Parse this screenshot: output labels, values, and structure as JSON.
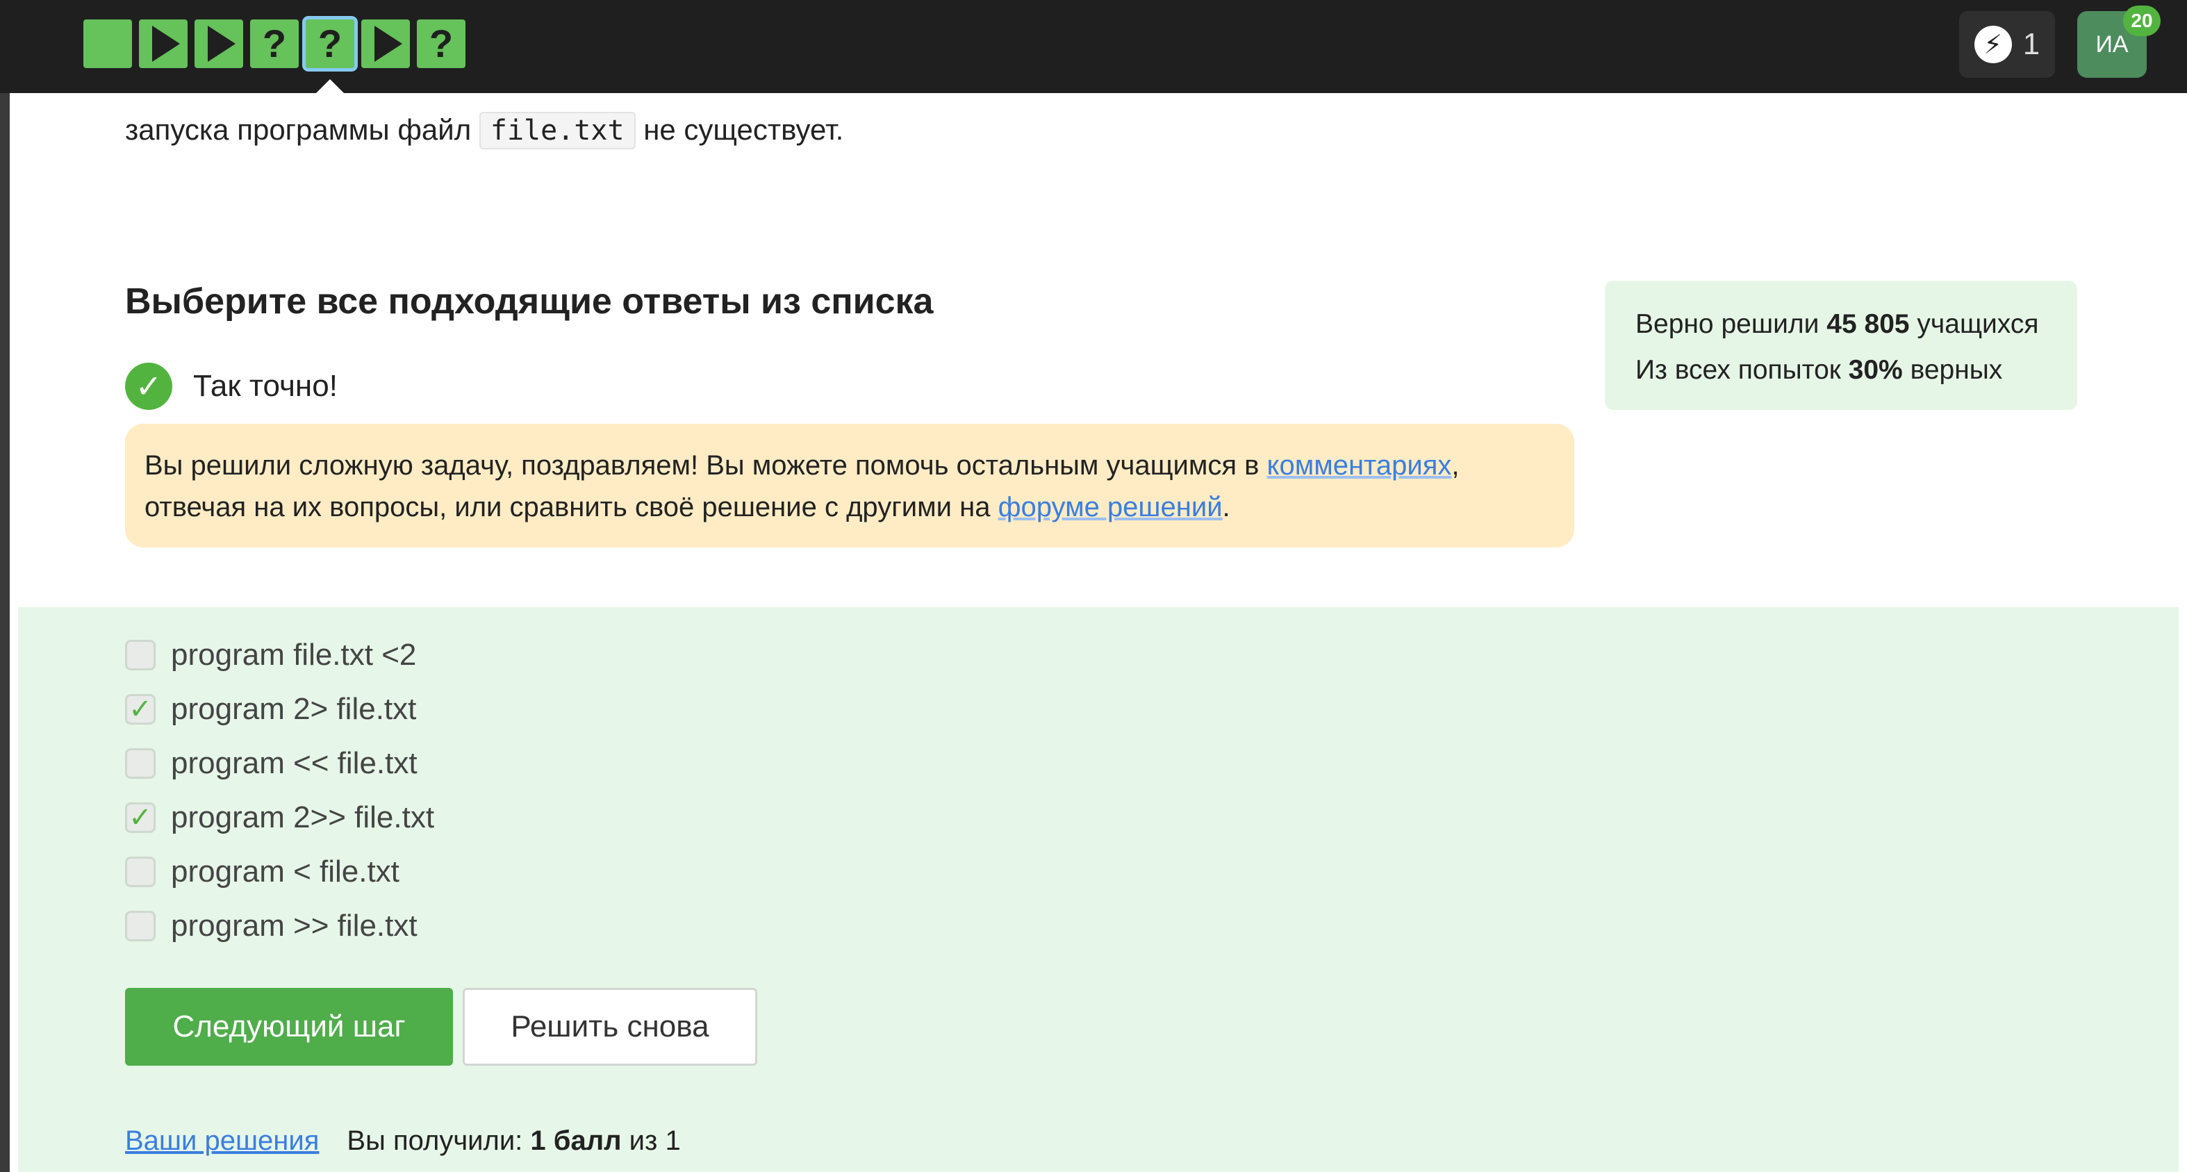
{
  "topbar": {
    "steps": [
      {
        "type": "text",
        "icon": "text-step-icon",
        "label": ""
      },
      {
        "type": "video",
        "icon": "play-icon",
        "label": ""
      },
      {
        "type": "video",
        "icon": "play-icon",
        "label": ""
      },
      {
        "type": "quiz",
        "icon": "question-icon",
        "label": "?"
      },
      {
        "type": "quiz",
        "icon": "question-icon",
        "label": "?",
        "current": true
      },
      {
        "type": "video",
        "icon": "play-icon",
        "label": ""
      },
      {
        "type": "quiz",
        "icon": "question-icon",
        "label": "?"
      }
    ],
    "energy_icon": "⚡",
    "energy_count": "1",
    "avatar_initials": "ИА",
    "avatar_badge": "20"
  },
  "intro": {
    "text_before": "запуска программы файл",
    "code": "file.txt",
    "text_after": "не существует."
  },
  "question": {
    "title": "Выберите все подходящие ответы из списка",
    "success_icon": "✓",
    "success_text": "Так точно!"
  },
  "notice": {
    "text_1": "Вы решили сложную задачу, поздравляем! Вы можете помочь остальным учащимся в ",
    "link_1": "комментариях",
    "text_2": ", отвечая на их вопросы, или сравнить своё решение с другими на ",
    "link_2": "форуме решений",
    "text_3": "."
  },
  "stats": {
    "line1_prefix": "Верно решили ",
    "line1_value": "45 805",
    "line1_suffix": " учащихся",
    "line2_prefix": "Из всех попыток ",
    "line2_value": "30%",
    "line2_suffix": " верных"
  },
  "options": [
    {
      "label": "program file.txt <2",
      "checked": false
    },
    {
      "label": "program 2> file.txt",
      "checked": true
    },
    {
      "label": "program << file.txt",
      "checked": false
    },
    {
      "label": "program 2>> file.txt",
      "checked": true
    },
    {
      "label": "program < file.txt",
      "checked": false
    },
    {
      "label": "program >> file.txt",
      "checked": false
    }
  ],
  "check_mark": "✓",
  "buttons": {
    "next": "Следующий шаг",
    "again": "Решить снова"
  },
  "footer": {
    "solutions_link": "Ваши решения",
    "score_prefix": "Вы получили: ",
    "score_value": "1 балл",
    "score_suffix": " из 1"
  },
  "colors": {
    "topbar_bg": "#1f1f1f",
    "step_green": "#66c25a",
    "accent_green": "#4fad4a",
    "answers_bg": "#e6f6e8",
    "notice_bg": "#ffecc5",
    "link_blue": "#3a7ee0"
  }
}
